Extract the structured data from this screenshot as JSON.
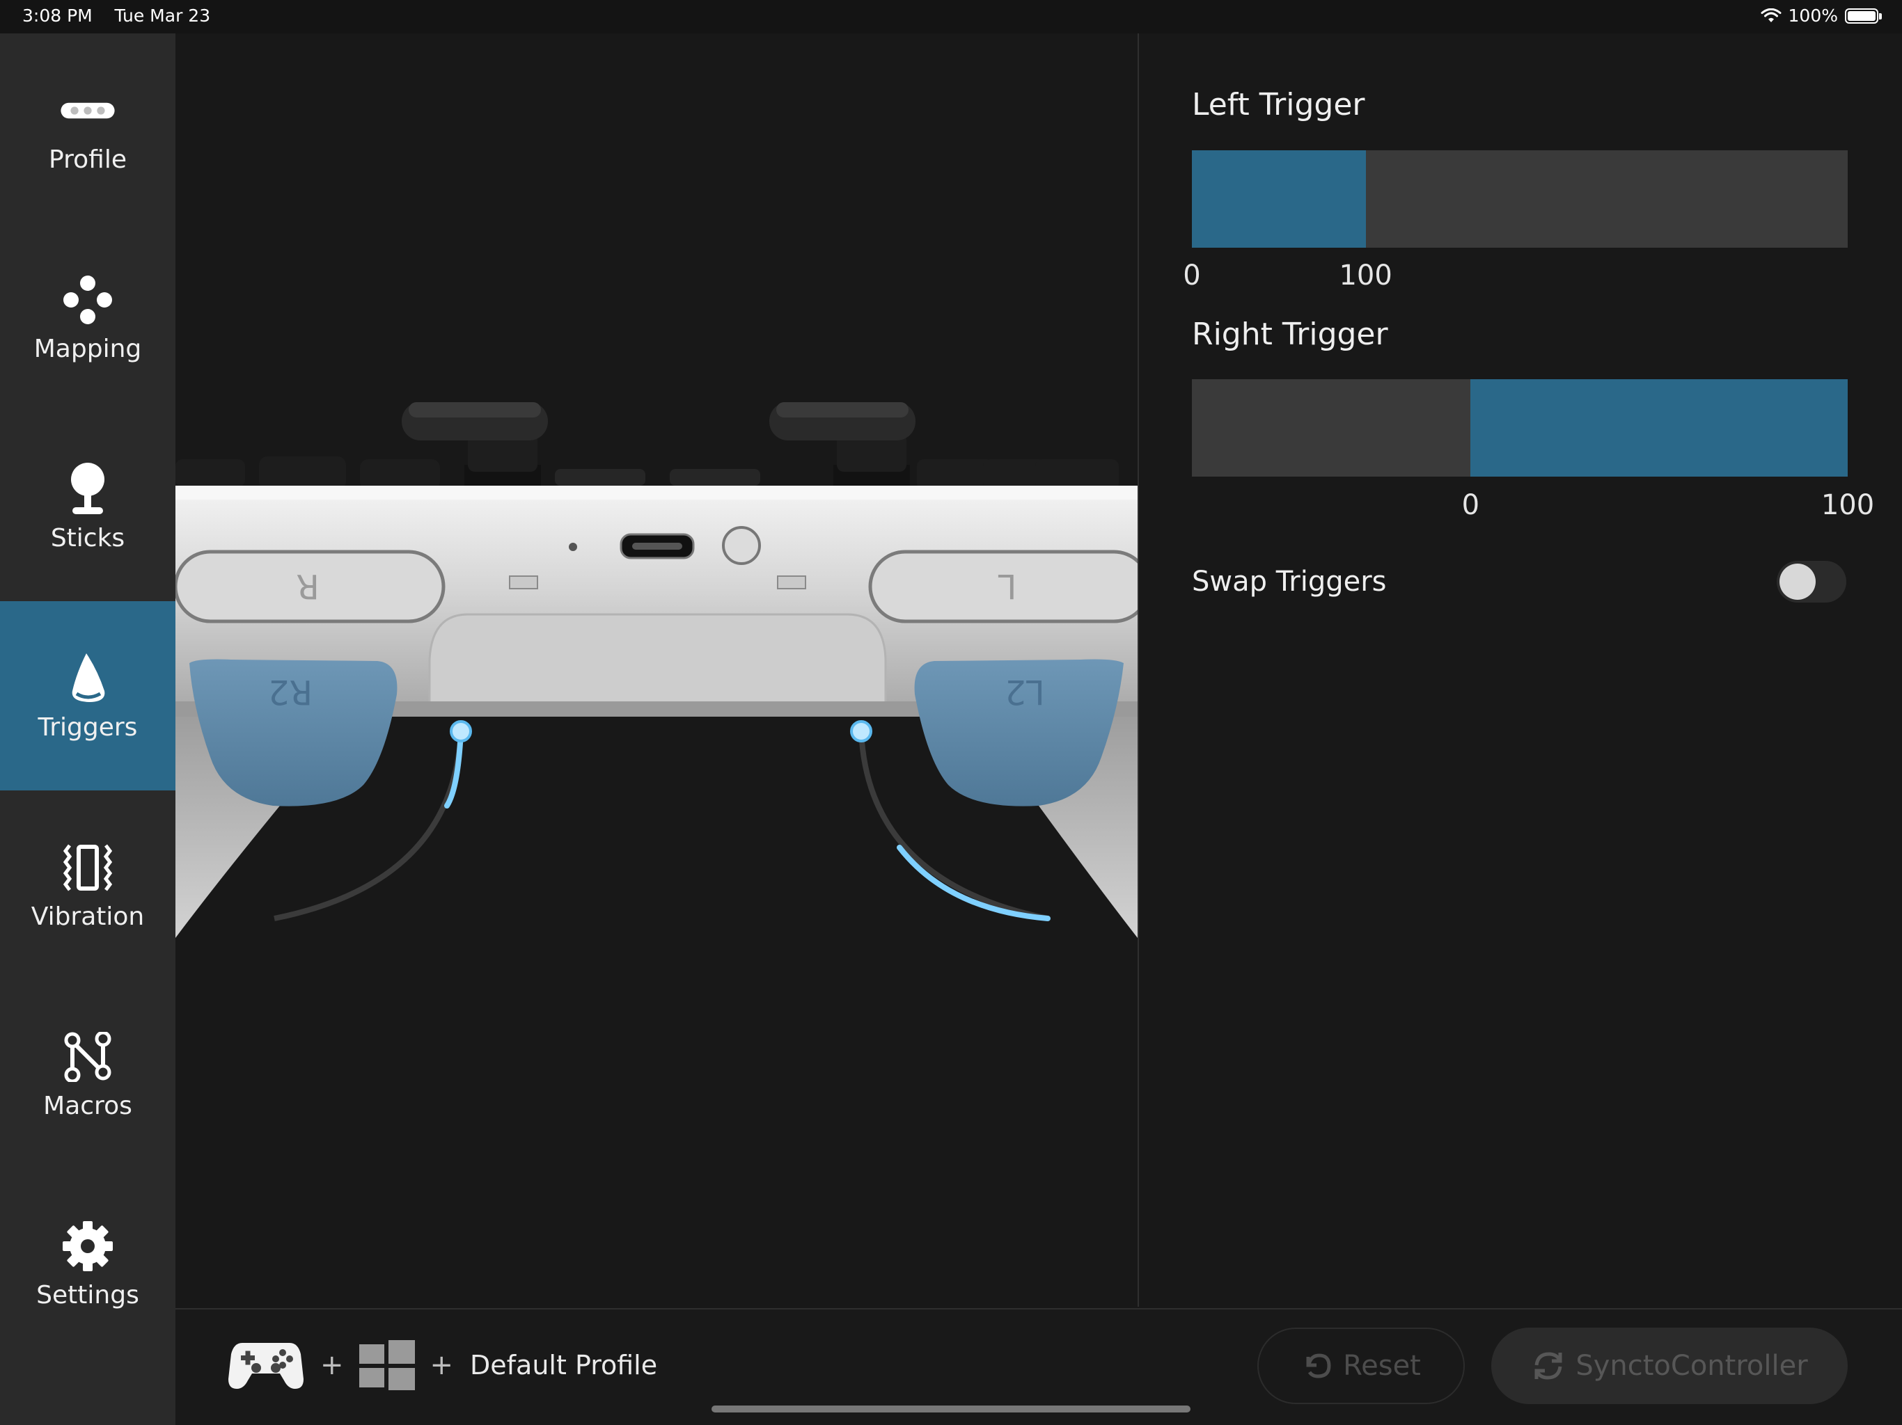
{
  "status_bar": {
    "time": "3:08 PM",
    "date": "Tue Mar 23",
    "battery": "100%"
  },
  "sidebar": {
    "items": [
      {
        "label": "Profile",
        "icon": "profile-pill-icon",
        "active": false
      },
      {
        "label": "Mapping",
        "icon": "dpad-dots-icon",
        "active": false
      },
      {
        "label": "Sticks",
        "icon": "joystick-icon",
        "active": false
      },
      {
        "label": "Triggers",
        "icon": "trigger-icon",
        "active": true
      },
      {
        "label": "Vibration",
        "icon": "vibration-icon",
        "active": false
      },
      {
        "label": "Macros",
        "icon": "macro-nodes-icon",
        "active": false
      },
      {
        "label": "Settings",
        "icon": "gear-icon",
        "active": false
      }
    ]
  },
  "controller": {
    "face_labels": {
      "right_bumper": "R",
      "left_bumper": "L",
      "right_trigger": "R2",
      "left_trigger": "L2"
    }
  },
  "left_trigger": {
    "title": "Left Trigger",
    "min_label": "0",
    "max_label": "100",
    "range_start": 0,
    "range_end": 0.265
  },
  "right_trigger": {
    "title": "Right Trigger",
    "min_label": "0",
    "max_label": "100",
    "range_start": 0.425,
    "range_end": 1.0
  },
  "swap": {
    "label": "Swap Triggers",
    "enabled": false
  },
  "bottom": {
    "profile_name": "Default Profile",
    "plus": "+",
    "reset_label": "Reset",
    "sync_label": "SynctoController"
  },
  "colors": {
    "accent": "#2a6889",
    "background": "#181818",
    "sidebar": "#2a2a2a",
    "trigger_blue": "#5e89aa",
    "glow": "#7fd0ff"
  }
}
